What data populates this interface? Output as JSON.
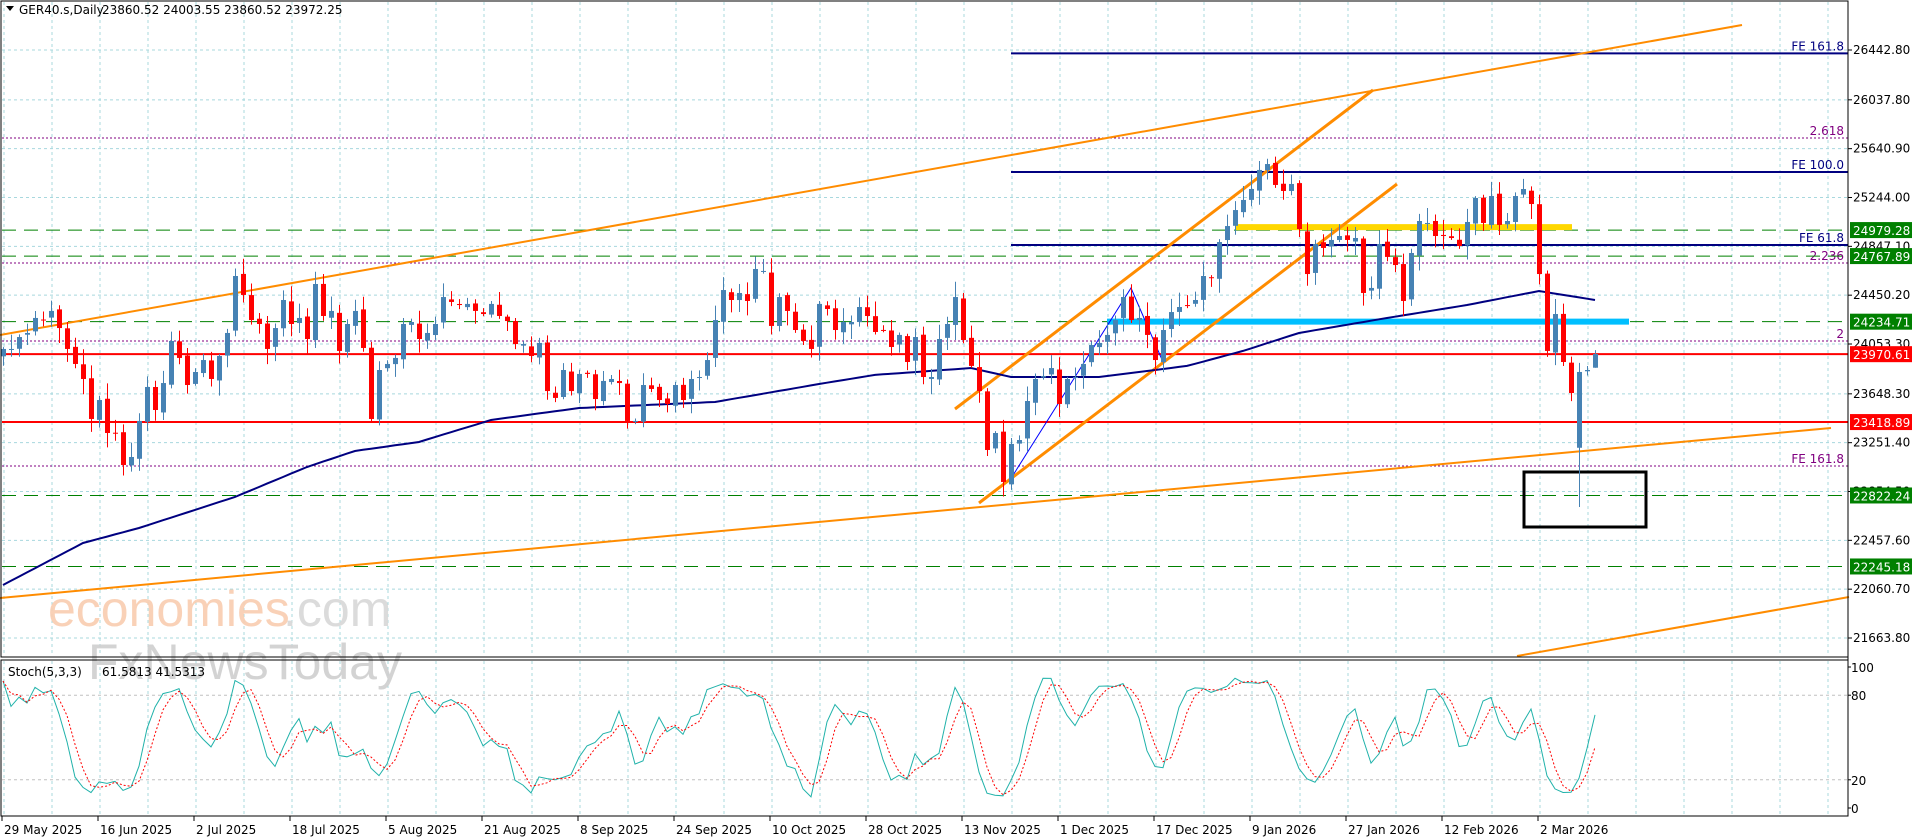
{
  "header": {
    "symbol": "GER40.s,Daily",
    "ohlc": "23860.52 24003.55 23860.52 23972.25"
  },
  "indicator": {
    "label": "Stoch(5,3,3)",
    "values": "61.5813 41.5313"
  },
  "watermark": {
    "brand1": "economies",
    "brand1_suffix": ".com",
    "brand2": "FxNewsToday"
  },
  "colors": {
    "up": "#4682B4",
    "down": "#FF0000",
    "ma": "#000080",
    "trend": "#FF8C00",
    "grid": "#A8D8DE",
    "support": "#008000",
    "resistance": "#FF0000",
    "fib": "#800080",
    "fe": "#000080",
    "stoch_k": "#20B2AA",
    "stoch_d": "#FF0000"
  },
  "price_axis": {
    "ticks": [
      {
        "price": 26442.8,
        "label": "26442.80"
      },
      {
        "price": 26037.8,
        "label": "26037.80"
      },
      {
        "price": 25640.9,
        "label": "25640.90"
      },
      {
        "price": 25244.0,
        "label": "25244.00"
      },
      {
        "price": 24847.1,
        "label": "24847.10"
      },
      {
        "price": 24450.2,
        "label": "24450.20"
      },
      {
        "price": 24053.3,
        "label": "24053.30"
      },
      {
        "price": 23648.3,
        "label": "23648.30"
      },
      {
        "price": 23251.4,
        "label": "23251.40"
      },
      {
        "price": 22854.5,
        "label": "22854.50"
      },
      {
        "price": 22457.6,
        "label": "22457.60"
      },
      {
        "price": 22060.7,
        "label": "22060.70"
      },
      {
        "price": 21663.8,
        "label": "21663.80"
      }
    ],
    "stoch_ticks": [
      {
        "v": 100,
        "label": "100"
      },
      {
        "v": 80,
        "label": "80"
      },
      {
        "v": 20,
        "label": "20"
      },
      {
        "v": 0,
        "label": "0"
      }
    ]
  },
  "levels": [
    {
      "price": 24979.28,
      "label": "24979.28",
      "type": "support"
    },
    {
      "price": 24767.89,
      "label": "24767.89",
      "type": "support"
    },
    {
      "price": 24234.71,
      "label": "24234.71",
      "type": "support"
    },
    {
      "price": 22822.24,
      "label": "22822.24",
      "type": "support"
    },
    {
      "price": 22245.18,
      "label": "22245.18",
      "type": "support"
    },
    {
      "price": 23970.61,
      "label": "23970.61",
      "type": "resistance"
    },
    {
      "price": 23418.89,
      "label": "23418.89",
      "type": "resistance"
    }
  ],
  "fib_levels": [
    {
      "price": 26415,
      "label": "FE 161.8",
      "type": "fe"
    },
    {
      "price": 25451,
      "label": "FE 100.0",
      "type": "fe"
    },
    {
      "price": 24858,
      "label": "FE 61.8",
      "type": "fe"
    },
    {
      "price": 25728,
      "label": "2.618",
      "type": "fib"
    },
    {
      "price": 24712,
      "label": "2.236",
      "type": "fib"
    },
    {
      "price": 24078,
      "label": "2",
      "type": "fib"
    },
    {
      "price": 23062,
      "label": "FE 161.8",
      "type": "fib"
    }
  ],
  "chart_data": {
    "type": "candlestick",
    "title": "GER40.s,Daily",
    "ylim": [
      21509,
      26849
    ],
    "date_labels": [
      {
        "bar": 0,
        "label": "29 May 2025"
      },
      {
        "bar": 12,
        "label": "16 Jun 2025"
      },
      {
        "bar": 24,
        "label": "2 Jul 2025"
      },
      {
        "bar": 36,
        "label": "18 Jul 2025"
      },
      {
        "bar": 48,
        "label": "5 Aug 2025"
      },
      {
        "bar": 60,
        "label": "21 Aug 2025"
      },
      {
        "bar": 72,
        "label": "8 Sep 2025"
      },
      {
        "bar": 84,
        "label": "24 Sep 2025"
      },
      {
        "bar": 96,
        "label": "10 Oct 2025"
      },
      {
        "bar": 108,
        "label": "28 Oct 2025"
      },
      {
        "bar": 120,
        "label": "13 Nov 2025"
      },
      {
        "bar": 132,
        "label": "1 Dec 2025"
      },
      {
        "bar": 144,
        "label": "17 Dec 2025"
      },
      {
        "bar": 156,
        "label": "9 Jan 2026"
      },
      {
        "bar": 168,
        "label": "27 Jan 2026"
      },
      {
        "bar": 180,
        "label": "12 Feb 2026"
      },
      {
        "bar": 192,
        "label": "2 Mar 2026"
      }
    ],
    "close": [
      24013,
      24013,
      24110,
      24143,
      24265,
      24248,
      24322,
      24183,
      24013,
      23891,
      23769,
      23444,
      23598,
      23330,
      23330,
      23070,
      23135,
      23428,
      23704,
      23517,
      23736,
      24078,
      23940,
      23720,
      23826,
      23923,
      23769,
      23956,
      24143,
      24606,
      24452,
      24248,
      24216,
      24013,
      24183,
      24411,
      24216,
      24265,
      24094,
      24541,
      24281,
      24322,
      23997,
      24216,
      24322,
      24021,
      23444,
      23842,
      23891,
      23940,
      24216,
      24232,
      24094,
      24143,
      24216,
      24435,
      24395,
      24370,
      24379,
      24322,
      24297,
      24379,
      24281,
      24240,
      24053,
      24053,
      23956,
      24062,
      23671,
      23615,
      23842,
      23671,
      23810,
      23810,
      23606,
      23753,
      23769,
      23736,
      23428,
      23428,
      23720,
      23688,
      23598,
      23566,
      23720,
      23598,
      23769,
      23785,
      23923,
      24248,
      24492,
      24411,
      24468,
      24403,
      24663,
      24647,
      24200,
      24435,
      24322,
      24167,
      24078,
      24013,
      24379,
      24338,
      24167,
      24232,
      24232,
      24354,
      24281,
      24151,
      24167,
      24029,
      24127,
      23907,
      24110,
      23785,
      23785,
      24094,
      24216,
      24435,
      24086,
      23875,
      23671,
      23192,
      23330,
      22932,
      23241,
      23273,
      23590,
      23769,
      23793,
      23858,
      23566,
      23769,
      23785,
      23891,
      24045,
      24062,
      24127,
      24248,
      24435,
      24248,
      24265,
      24127,
      23923,
      24167,
      24313,
      24354,
      24362,
      24411,
      24606,
      24590,
      24882,
      25012,
      25142,
      25224,
      25313,
      25468,
      25516,
      25346,
      25297,
      25354,
      24988,
      24622,
      24866,
      24834,
      24899,
      24931,
      24899,
      24915,
      24468,
      24509,
      24866,
      24761,
      24695,
      24403,
      24793,
      25053,
      25037,
      24931,
      24931,
      24915,
      24850,
      25045,
      25240,
      25037,
      25256,
      25021,
      25053,
      25256,
      25313,
      25191,
      24622,
      23997,
      24297,
      23907,
      23655,
      23826,
      23842,
      23972.25
    ],
    "bar_overrides": [
      {
        "bar": 197,
        "open": 23210,
        "high": 23900,
        "low": 22729
      },
      {
        "bar": 199,
        "open": 23860.52,
        "high": 24003.55,
        "low": 23860.52
      }
    ],
    "moving_average": [
      [
        0,
        22095
      ],
      [
        10,
        22436
      ],
      [
        17,
        22558
      ],
      [
        29,
        22810
      ],
      [
        38,
        23054
      ],
      [
        44,
        23184
      ],
      [
        52,
        23257
      ],
      [
        61,
        23436
      ],
      [
        72,
        23533
      ],
      [
        89,
        23582
      ],
      [
        102,
        23728
      ],
      [
        109,
        23802
      ],
      [
        121,
        23858
      ],
      [
        126,
        23785
      ],
      [
        137,
        23785
      ],
      [
        148,
        23875
      ],
      [
        155,
        23997
      ],
      [
        162,
        24143
      ],
      [
        173,
        24265
      ],
      [
        183,
        24370
      ],
      [
        192,
        24484
      ],
      [
        199,
        24411
      ]
    ],
    "stochastic": {
      "k_period": 5,
      "slowing": 3,
      "d_period": 3,
      "levels": [
        80,
        20
      ],
      "range": [
        0,
        100
      ]
    }
  }
}
